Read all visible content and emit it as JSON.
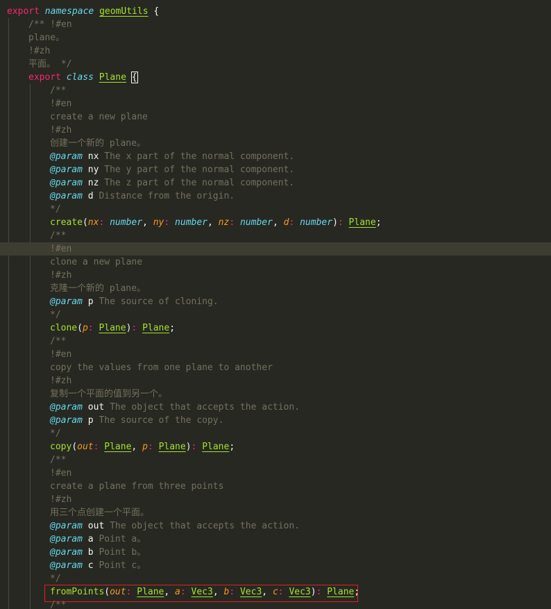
{
  "editor": {
    "highlighted_line": 18,
    "lines": [
      {
        "indent": 0,
        "tokens": [
          {
            "t": "kw",
            "v": "export"
          },
          {
            "t": "txt",
            "v": " "
          },
          {
            "t": "st",
            "v": "namespace"
          },
          {
            "t": "txt",
            "v": " "
          },
          {
            "t": "cls",
            "v": "geomUtils"
          },
          {
            "t": "txt",
            "v": " {"
          }
        ]
      },
      {
        "indent": 1,
        "tokens": [
          {
            "t": "cm",
            "v": "/** !#en"
          }
        ]
      },
      {
        "indent": 1,
        "tokens": [
          {
            "t": "cm",
            "v": "plane。"
          }
        ]
      },
      {
        "indent": 1,
        "tokens": [
          {
            "t": "cm",
            "v": "!#zh"
          }
        ]
      },
      {
        "indent": 1,
        "tokens": [
          {
            "t": "cm",
            "v": "平面。 */"
          }
        ]
      },
      {
        "indent": 1,
        "tokens": [
          {
            "t": "kw",
            "v": "export"
          },
          {
            "t": "txt",
            "v": " "
          },
          {
            "t": "st",
            "v": "class"
          },
          {
            "t": "txt",
            "v": " "
          },
          {
            "t": "cls",
            "v": "Plane"
          },
          {
            "t": "txt",
            "v": " "
          },
          {
            "t": "bracket",
            "v": "{"
          }
        ]
      },
      {
        "indent": 2,
        "tokens": [
          {
            "t": "cm",
            "v": "/**"
          }
        ]
      },
      {
        "indent": 2,
        "tokens": [
          {
            "t": "cm",
            "v": "!#en"
          }
        ]
      },
      {
        "indent": 2,
        "tokens": [
          {
            "t": "cm",
            "v": "create a new plane"
          }
        ]
      },
      {
        "indent": 2,
        "tokens": [
          {
            "t": "cm",
            "v": "!#zh"
          }
        ]
      },
      {
        "indent": 2,
        "tokens": [
          {
            "t": "cm",
            "v": "创建一个新的 plane。"
          }
        ]
      },
      {
        "indent": 2,
        "tokens": [
          {
            "t": "tag",
            "v": "@param"
          },
          {
            "t": "txt",
            "v": " nx"
          },
          {
            "t": "cm",
            "v": " The x part of the normal component."
          }
        ]
      },
      {
        "indent": 2,
        "tokens": [
          {
            "t": "tag",
            "v": "@param"
          },
          {
            "t": "txt",
            "v": " ny"
          },
          {
            "t": "cm",
            "v": " The y part of the normal component."
          }
        ]
      },
      {
        "indent": 2,
        "tokens": [
          {
            "t": "tag",
            "v": "@param"
          },
          {
            "t": "txt",
            "v": " nz"
          },
          {
            "t": "cm",
            "v": " The z part of the normal component."
          }
        ]
      },
      {
        "indent": 2,
        "tokens": [
          {
            "t": "tag",
            "v": "@param"
          },
          {
            "t": "txt",
            "v": " d"
          },
          {
            "t": "cm",
            "v": " Distance from the origin."
          }
        ]
      },
      {
        "indent": 2,
        "tokens": [
          {
            "t": "cm",
            "v": "*/"
          }
        ]
      },
      {
        "indent": 2,
        "tokens": [
          {
            "t": "fn",
            "v": "create"
          },
          {
            "t": "pn",
            "v": "("
          },
          {
            "t": "pr",
            "v": "nx"
          },
          {
            "t": "kw",
            "v": ":"
          },
          {
            "t": "txt",
            "v": " "
          },
          {
            "t": "ty",
            "v": "number"
          },
          {
            "t": "pn",
            "v": ", "
          },
          {
            "t": "pr",
            "v": "ny"
          },
          {
            "t": "kw",
            "v": ":"
          },
          {
            "t": "txt",
            "v": " "
          },
          {
            "t": "ty",
            "v": "number"
          },
          {
            "t": "pn",
            "v": ", "
          },
          {
            "t": "pr",
            "v": "nz"
          },
          {
            "t": "kw",
            "v": ":"
          },
          {
            "t": "txt",
            "v": " "
          },
          {
            "t": "ty",
            "v": "number"
          },
          {
            "t": "pn",
            "v": ", "
          },
          {
            "t": "pr",
            "v": "d"
          },
          {
            "t": "kw",
            "v": ":"
          },
          {
            "t": "txt",
            "v": " "
          },
          {
            "t": "ty",
            "v": "number"
          },
          {
            "t": "pn",
            "v": ")"
          },
          {
            "t": "kw",
            "v": ":"
          },
          {
            "t": "txt",
            "v": " "
          },
          {
            "t": "cls",
            "v": "Plane"
          },
          {
            "t": "pn",
            "v": ";"
          }
        ]
      },
      {
        "indent": 2,
        "tokens": [
          {
            "t": "cm",
            "v": "/**"
          }
        ]
      },
      {
        "indent": 2,
        "tokens": [
          {
            "t": "cm",
            "v": "!#en"
          }
        ]
      },
      {
        "indent": 2,
        "tokens": [
          {
            "t": "cm",
            "v": "clone a new plane"
          }
        ]
      },
      {
        "indent": 2,
        "tokens": [
          {
            "t": "cm",
            "v": "!#zh"
          }
        ]
      },
      {
        "indent": 2,
        "tokens": [
          {
            "t": "cm",
            "v": "克隆一个新的 plane。"
          }
        ]
      },
      {
        "indent": 2,
        "tokens": [
          {
            "t": "tag",
            "v": "@param"
          },
          {
            "t": "txt",
            "v": " p"
          },
          {
            "t": "cm",
            "v": " The source of cloning."
          }
        ]
      },
      {
        "indent": 2,
        "tokens": [
          {
            "t": "cm",
            "v": "*/"
          }
        ]
      },
      {
        "indent": 2,
        "tokens": [
          {
            "t": "fn",
            "v": "clone"
          },
          {
            "t": "pn",
            "v": "("
          },
          {
            "t": "pr",
            "v": "p"
          },
          {
            "t": "kw",
            "v": ":"
          },
          {
            "t": "txt",
            "v": " "
          },
          {
            "t": "cls",
            "v": "Plane"
          },
          {
            "t": "pn",
            "v": ")"
          },
          {
            "t": "kw",
            "v": ":"
          },
          {
            "t": "txt",
            "v": " "
          },
          {
            "t": "cls",
            "v": "Plane"
          },
          {
            "t": "pn",
            "v": ";"
          }
        ]
      },
      {
        "indent": 2,
        "tokens": [
          {
            "t": "cm",
            "v": "/**"
          }
        ]
      },
      {
        "indent": 2,
        "tokens": [
          {
            "t": "cm",
            "v": "!#en"
          }
        ]
      },
      {
        "indent": 2,
        "tokens": [
          {
            "t": "cm",
            "v": "copy the values from one plane to another"
          }
        ]
      },
      {
        "indent": 2,
        "tokens": [
          {
            "t": "cm",
            "v": "!#zh"
          }
        ]
      },
      {
        "indent": 2,
        "tokens": [
          {
            "t": "cm",
            "v": "复制一个平面的值到另一个。"
          }
        ]
      },
      {
        "indent": 2,
        "tokens": [
          {
            "t": "tag",
            "v": "@param"
          },
          {
            "t": "txt",
            "v": " out"
          },
          {
            "t": "cm",
            "v": " The object that accepts the action."
          }
        ]
      },
      {
        "indent": 2,
        "tokens": [
          {
            "t": "tag",
            "v": "@param"
          },
          {
            "t": "txt",
            "v": " p"
          },
          {
            "t": "cm",
            "v": " The source of the copy."
          }
        ]
      },
      {
        "indent": 2,
        "tokens": [
          {
            "t": "cm",
            "v": "*/"
          }
        ]
      },
      {
        "indent": 2,
        "tokens": [
          {
            "t": "fn",
            "v": "copy"
          },
          {
            "t": "pn",
            "v": "("
          },
          {
            "t": "pr",
            "v": "out"
          },
          {
            "t": "kw",
            "v": ":"
          },
          {
            "t": "txt",
            "v": " "
          },
          {
            "t": "cls",
            "v": "Plane"
          },
          {
            "t": "pn",
            "v": ", "
          },
          {
            "t": "pr",
            "v": "p"
          },
          {
            "t": "kw",
            "v": ":"
          },
          {
            "t": "txt",
            "v": " "
          },
          {
            "t": "cls",
            "v": "Plane"
          },
          {
            "t": "pn",
            "v": ")"
          },
          {
            "t": "kw",
            "v": ":"
          },
          {
            "t": "txt",
            "v": " "
          },
          {
            "t": "cls",
            "v": "Plane"
          },
          {
            "t": "pn",
            "v": ";"
          }
        ]
      },
      {
        "indent": 2,
        "tokens": [
          {
            "t": "cm",
            "v": "/**"
          }
        ]
      },
      {
        "indent": 2,
        "tokens": [
          {
            "t": "cm",
            "v": "!#en"
          }
        ]
      },
      {
        "indent": 2,
        "tokens": [
          {
            "t": "cm",
            "v": "create a plane from three points"
          }
        ]
      },
      {
        "indent": 2,
        "tokens": [
          {
            "t": "cm",
            "v": "!#zh"
          }
        ]
      },
      {
        "indent": 2,
        "tokens": [
          {
            "t": "cm",
            "v": "用三个点创建一个平面。"
          }
        ]
      },
      {
        "indent": 2,
        "tokens": [
          {
            "t": "tag",
            "v": "@param"
          },
          {
            "t": "txt",
            "v": " out"
          },
          {
            "t": "cm",
            "v": " The object that accepts the action."
          }
        ]
      },
      {
        "indent": 2,
        "tokens": [
          {
            "t": "tag",
            "v": "@param"
          },
          {
            "t": "txt",
            "v": " a"
          },
          {
            "t": "cm",
            "v": " Point a。"
          }
        ]
      },
      {
        "indent": 2,
        "tokens": [
          {
            "t": "tag",
            "v": "@param"
          },
          {
            "t": "txt",
            "v": " b"
          },
          {
            "t": "cm",
            "v": " Point b。"
          }
        ]
      },
      {
        "indent": 2,
        "tokens": [
          {
            "t": "tag",
            "v": "@param"
          },
          {
            "t": "txt",
            "v": " c"
          },
          {
            "t": "cm",
            "v": " Point c。"
          }
        ]
      },
      {
        "indent": 2,
        "tokens": [
          {
            "t": "cm",
            "v": "*/"
          }
        ]
      },
      {
        "indent": 2,
        "tokens": [
          {
            "t": "fn",
            "v": "fromPoints"
          },
          {
            "t": "pn",
            "v": "("
          },
          {
            "t": "pr",
            "v": "out"
          },
          {
            "t": "kw",
            "v": ":"
          },
          {
            "t": "txt",
            "v": " "
          },
          {
            "t": "cls",
            "v": "Plane"
          },
          {
            "t": "pn",
            "v": ", "
          },
          {
            "t": "pr",
            "v": "a"
          },
          {
            "t": "kw",
            "v": ":"
          },
          {
            "t": "txt",
            "v": " "
          },
          {
            "t": "cls",
            "v": "Vec3"
          },
          {
            "t": "pn",
            "v": ", "
          },
          {
            "t": "pr",
            "v": "b"
          },
          {
            "t": "kw",
            "v": ":"
          },
          {
            "t": "txt",
            "v": " "
          },
          {
            "t": "cls",
            "v": "Vec3"
          },
          {
            "t": "pn",
            "v": ", "
          },
          {
            "t": "pr",
            "v": "c"
          },
          {
            "t": "kw",
            "v": ":"
          },
          {
            "t": "txt",
            "v": " "
          },
          {
            "t": "cls",
            "v": "Vec3"
          },
          {
            "t": "pn",
            "v": ")"
          },
          {
            "t": "kw",
            "v": ":"
          },
          {
            "t": "txt",
            "v": " "
          },
          {
            "t": "cls",
            "v": "Plane"
          },
          {
            "t": "pn",
            "v": ";"
          }
        ]
      },
      {
        "indent": 2,
        "tokens": [
          {
            "t": "cm",
            "v": "/**"
          }
        ]
      }
    ]
  }
}
